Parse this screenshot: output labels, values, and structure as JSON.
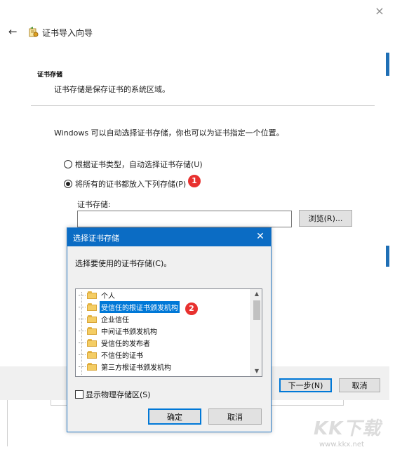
{
  "wizard": {
    "title": "证书导入向导",
    "section_title": "证书存储",
    "section_desc": "证书存储是保存证书的系统区域。",
    "intro": "Windows 可以自动选择证书存储，你也可以为证书指定一个位置。",
    "radio_auto": "根据证书类型，自动选择证书存储(U)",
    "radio_manual": "将所有的证书都放入下列存储(P)",
    "store_label": "证书存储:",
    "store_value": "",
    "browse": "浏览(R)...",
    "next": "下一步(N)",
    "cancel": "取消",
    "close": "×",
    "back": "←"
  },
  "badges": {
    "one": "1",
    "two": "2"
  },
  "dialog": {
    "title": "选择证书存储",
    "close": "✕",
    "prompt": "选择要使用的证书存储(C)。",
    "items": [
      "个人",
      "受信任的根证书颁发机构",
      "企业信任",
      "中间证书颁发机构",
      "受信任的发布者",
      "不信任的证书",
      "第三方根证书颁发机构"
    ],
    "selected_index": 1,
    "show_physical": "显示物理存储区(S)",
    "ok": "确定",
    "cancel": "取消"
  },
  "watermark": {
    "logo": "KK下载",
    "url": "www.kkx.net"
  },
  "colors": {
    "accent": "#0b6cc4",
    "badge": "#e8312f",
    "selection": "#0078d7"
  }
}
